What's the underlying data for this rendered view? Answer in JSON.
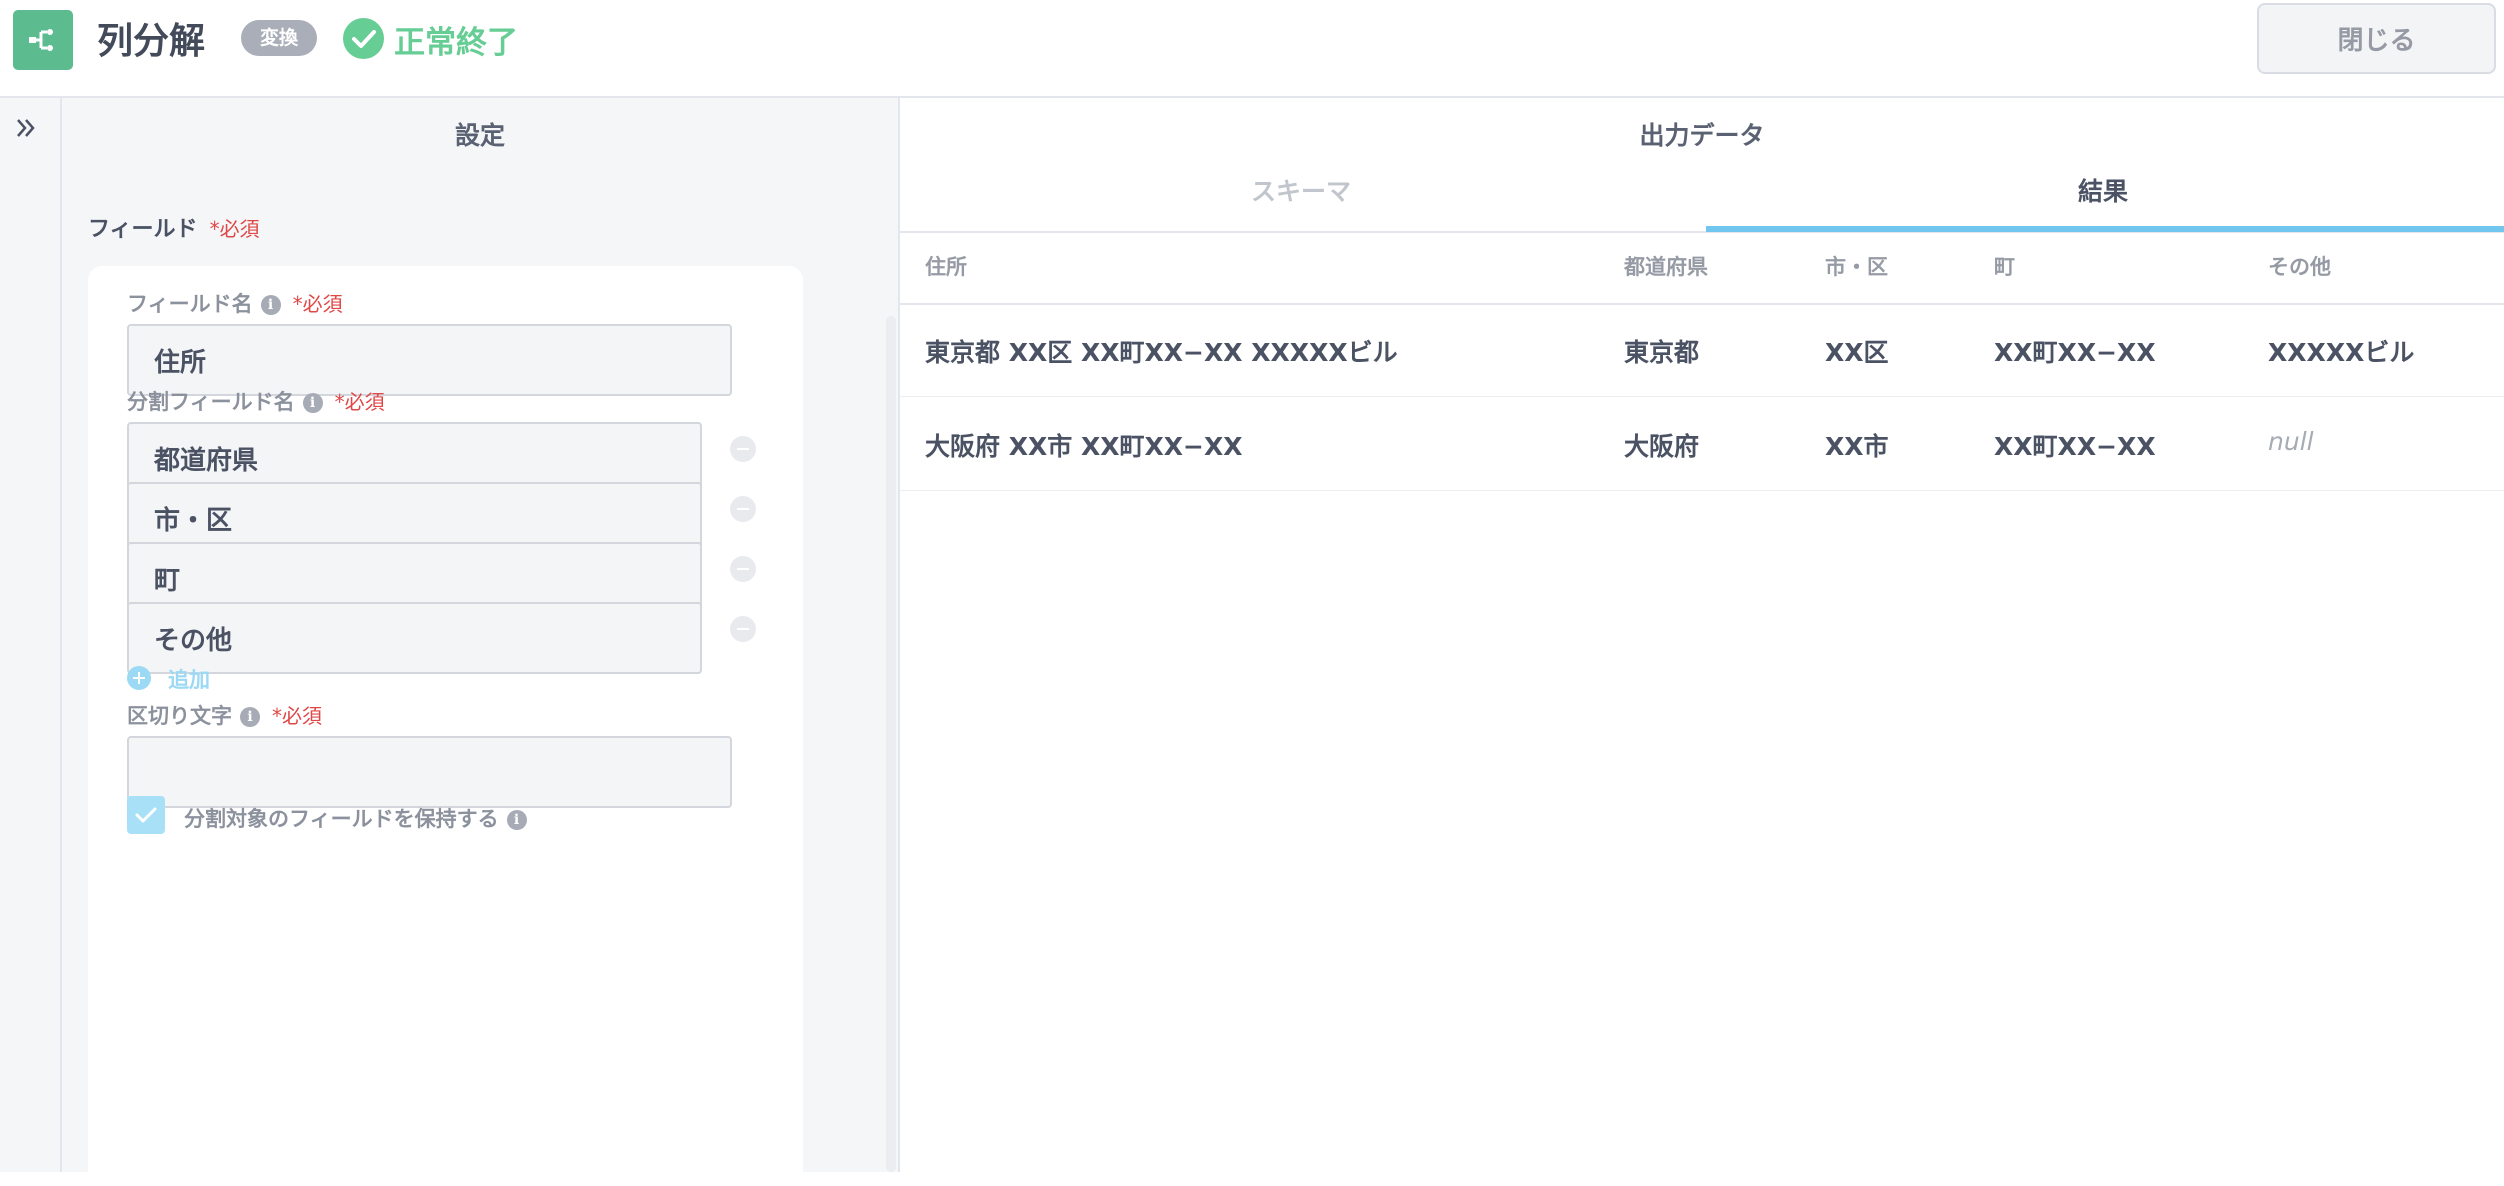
{
  "header": {
    "title": "列分解",
    "chip": "変換",
    "status": "正常終了",
    "close_label": "閉じる",
    "status_color": "#66cd94",
    "icon": "split-node-icon"
  },
  "settings": {
    "title": "設定",
    "field_section": {
      "label": "フィールド",
      "required": "*必須"
    },
    "field_name": {
      "label": "フィールド名",
      "required": "*必須",
      "value": "住所"
    },
    "split_fields": {
      "label": "分割フィールド名",
      "required": "*必須",
      "items": [
        {
          "value": "都道府県"
        },
        {
          "value": "市・区"
        },
        {
          "value": "町"
        },
        {
          "value": "その他"
        }
      ],
      "add_label": "追加"
    },
    "delimiter": {
      "label": "区切り文字",
      "required": "*必須",
      "value": ""
    },
    "keep_field": {
      "label": "分割対象のフィールドを保持する",
      "checked": true
    }
  },
  "output": {
    "title": "出力データ",
    "tabs": [
      {
        "label": "スキーマ",
        "active": false
      },
      {
        "label": "結果",
        "active": true
      }
    ],
    "columns": [
      "住所",
      "都道府県",
      "市・区",
      "町",
      "その他"
    ],
    "rows": [
      [
        "東京都 XX区 XX町XX−XX XXXXXビル",
        "東京都",
        "XX区",
        "XX町XX−XX",
        "XXXXXビル"
      ],
      [
        "大阪府 XX市 XX町XX−XX",
        "大阪府",
        "XX市",
        "XX町XX−XX",
        "null"
      ]
    ]
  },
  "colors": {
    "accent": "#70c6ee",
    "brand": "#5cbb8f",
    "required": "#e04848"
  }
}
